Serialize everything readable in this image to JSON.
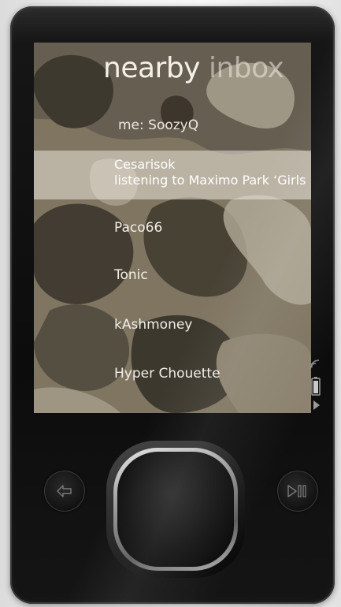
{
  "screen": {
    "title_word1": "nearby",
    "title_word2": "inbox",
    "me_label": "me: SoozyQ",
    "selected": {
      "name": "Cesarisok",
      "status": "listening to Maximo Park ‘Girls"
    },
    "list": [
      "Paco66",
      "Tonic",
      "kAshmoney",
      "Hyper Chouette"
    ]
  },
  "indicators": [
    "wireless-signal-icon",
    "battery-icon",
    "play-state-icon"
  ],
  "buttons": [
    "back-button",
    "play-pause-button",
    "zune-pad"
  ],
  "colors": {
    "screen_bg": "#8a7f6c",
    "camo_dark": "#4a4538",
    "camo_light": "#c9c0ae",
    "selection": "#e6e0d2"
  }
}
